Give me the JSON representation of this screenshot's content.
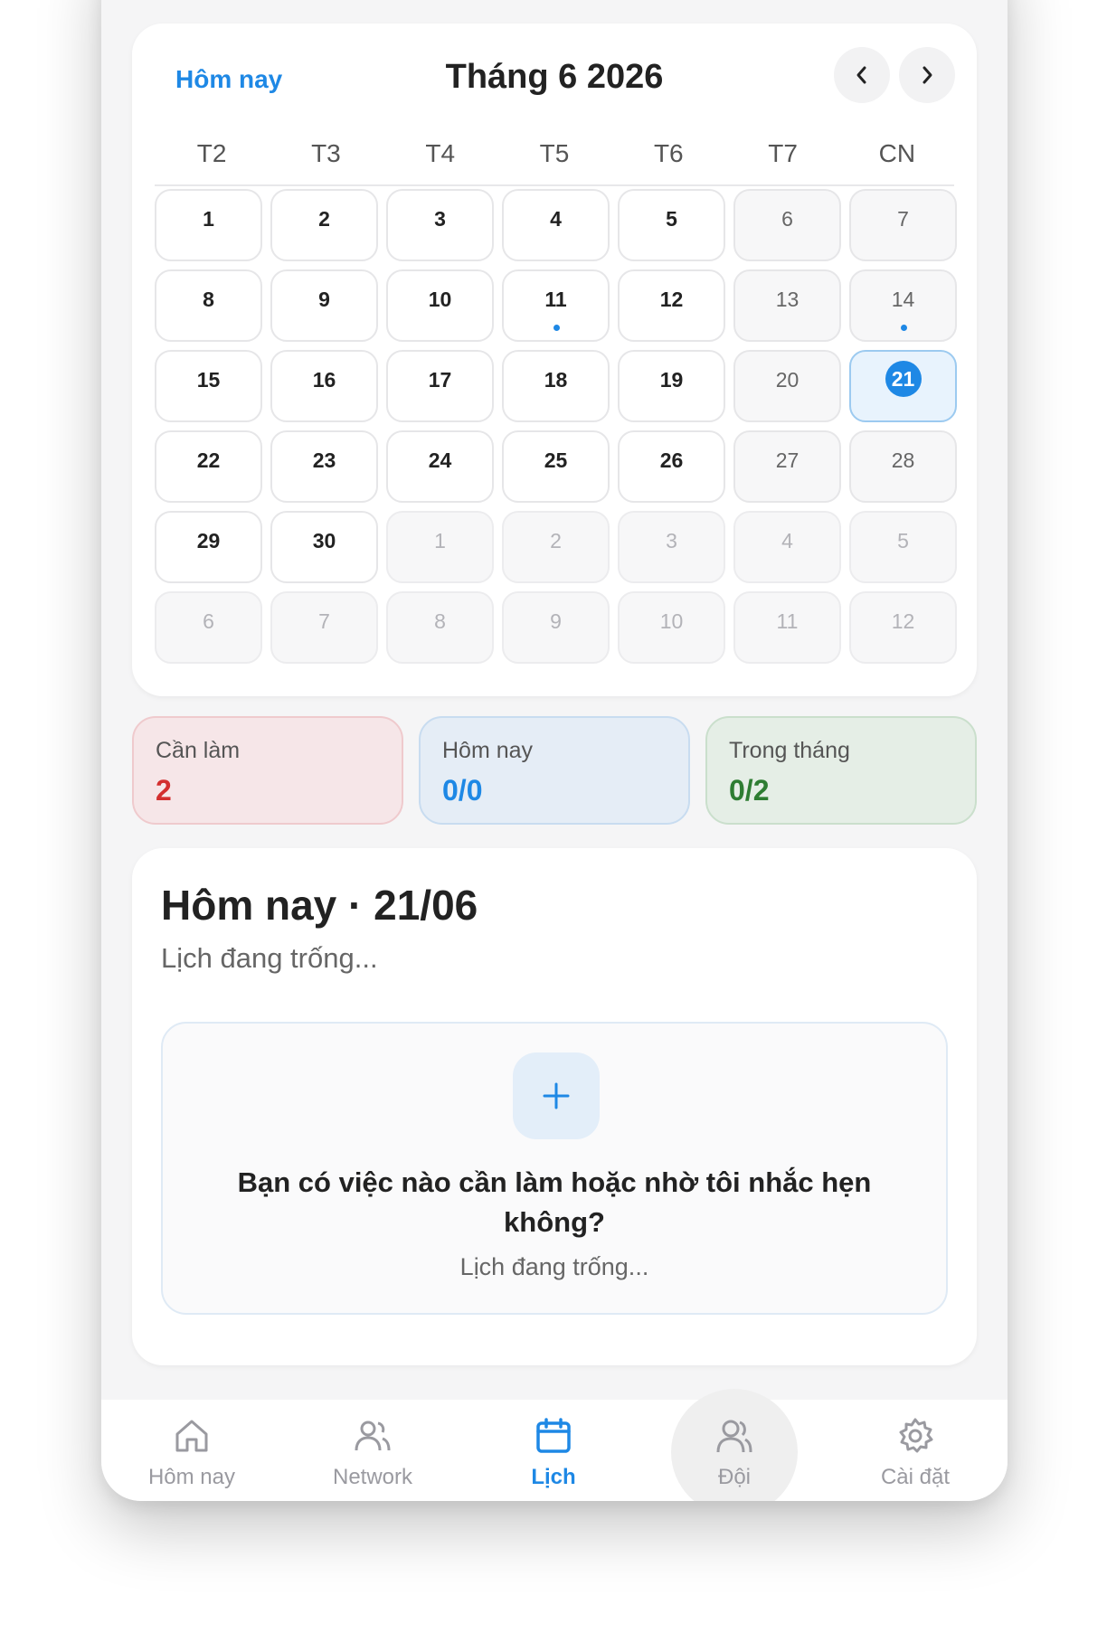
{
  "calendar": {
    "today_link": "Hôm nay",
    "month_title": "Tháng 6 2026",
    "prev_icon": "chevron-left-icon",
    "next_icon": "chevron-right-icon",
    "weekdays": [
      "T2",
      "T3",
      "T4",
      "T5",
      "T6",
      "T7",
      "CN"
    ],
    "days": [
      {
        "d": "1",
        "t": "cur"
      },
      {
        "d": "2",
        "t": "cur"
      },
      {
        "d": "3",
        "t": "cur"
      },
      {
        "d": "4",
        "t": "cur"
      },
      {
        "d": "5",
        "t": "cur"
      },
      {
        "d": "6",
        "t": "wk"
      },
      {
        "d": "7",
        "t": "wk"
      },
      {
        "d": "8",
        "t": "cur"
      },
      {
        "d": "9",
        "t": "cur"
      },
      {
        "d": "10",
        "t": "cur"
      },
      {
        "d": "11",
        "t": "cur",
        "dot": true
      },
      {
        "d": "12",
        "t": "cur"
      },
      {
        "d": "13",
        "t": "wk"
      },
      {
        "d": "14",
        "t": "wk",
        "dot": true
      },
      {
        "d": "15",
        "t": "cur"
      },
      {
        "d": "16",
        "t": "cur"
      },
      {
        "d": "17",
        "t": "cur"
      },
      {
        "d": "18",
        "t": "cur"
      },
      {
        "d": "19",
        "t": "cur"
      },
      {
        "d": "20",
        "t": "wk"
      },
      {
        "d": "21",
        "t": "sel"
      },
      {
        "d": "22",
        "t": "cur"
      },
      {
        "d": "23",
        "t": "cur"
      },
      {
        "d": "24",
        "t": "cur"
      },
      {
        "d": "25",
        "t": "cur"
      },
      {
        "d": "26",
        "t": "cur"
      },
      {
        "d": "27",
        "t": "wk"
      },
      {
        "d": "28",
        "t": "wk"
      },
      {
        "d": "29",
        "t": "cur"
      },
      {
        "d": "30",
        "t": "cur"
      },
      {
        "d": "1",
        "t": "oth"
      },
      {
        "d": "2",
        "t": "oth"
      },
      {
        "d": "3",
        "t": "oth"
      },
      {
        "d": "4",
        "t": "oth"
      },
      {
        "d": "5",
        "t": "oth"
      },
      {
        "d": "6",
        "t": "oth"
      },
      {
        "d": "7",
        "t": "oth"
      },
      {
        "d": "8",
        "t": "oth"
      },
      {
        "d": "9",
        "t": "oth"
      },
      {
        "d": "10",
        "t": "oth"
      },
      {
        "d": "11",
        "t": "oth"
      },
      {
        "d": "12",
        "t": "oth"
      }
    ]
  },
  "stats": {
    "todo": {
      "label": "Cần làm",
      "value": "2"
    },
    "today": {
      "label": "Hôm nay",
      "value": "0/0"
    },
    "month": {
      "label": "Trong tháng",
      "value": "0/2"
    }
  },
  "today_section": {
    "title": "Hôm nay · 21/06",
    "subtitle": "Lịch đang trống...",
    "empty_question": "Bạn có việc nào cần làm hoặc nhờ tôi nhắc hẹn không?",
    "empty_sub": "Lịch đang trống...",
    "add_icon": "plus-icon"
  },
  "tabs": [
    {
      "label": "Hôm nay",
      "icon": "home-icon"
    },
    {
      "label": "Network",
      "icon": "users-icon"
    },
    {
      "label": "Lịch",
      "icon": "calendar-icon",
      "active": true
    },
    {
      "label": "Đội",
      "icon": "team-icon"
    },
    {
      "label": "Cài đặt",
      "icon": "gear-icon"
    }
  ],
  "colors": {
    "accent": "#1e88e5",
    "danger": "#d32f2f",
    "success": "#2e7d32"
  }
}
